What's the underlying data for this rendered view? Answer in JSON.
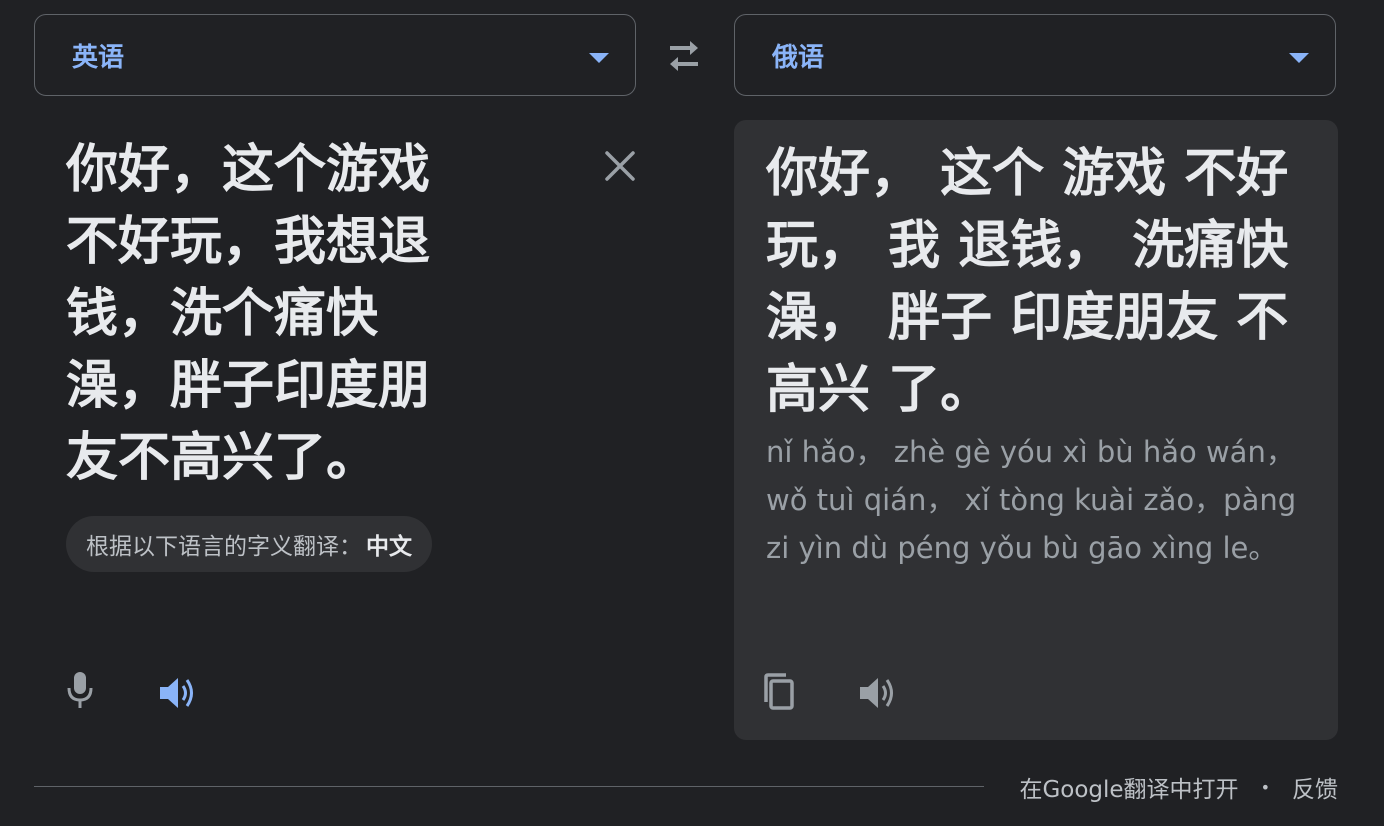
{
  "source": {
    "language": "英语",
    "text": "你好，这个游戏不好玩，我想退钱，洗个痛快澡，胖子印度朋友不高兴了。",
    "detected_prefix": "根据以下语言的字义翻译：",
    "detected_language": "中文"
  },
  "target": {
    "language": "俄语",
    "translation": "你好， 这个 游戏 不好玩， 我 退钱， 洗痛快 澡， 胖子 印度朋友 不高兴 了。",
    "pinyin": "nǐ hǎo， zhè gè yóu xì bù hǎo wán， wǒ tuì qián， xǐ tòng kuài zǎo，pàng zi yìn dù péng yǒu bù gāo xìng le。"
  },
  "footer": {
    "open_link": "在Google翻译中打开",
    "separator": "•",
    "feedback": "反馈"
  },
  "icons": {
    "swap": "swap-arrows-icon",
    "clear": "close-icon",
    "mic": "microphone-icon",
    "source_speaker": "speaker-icon",
    "copy": "copy-icon",
    "target_speaker": "speaker-icon"
  },
  "colors": {
    "background": "#202124",
    "panel": "#303134",
    "accent": "#8ab4f8",
    "text": "#e8eaed",
    "muted": "#9aa0a6",
    "border": "#5f6368"
  }
}
